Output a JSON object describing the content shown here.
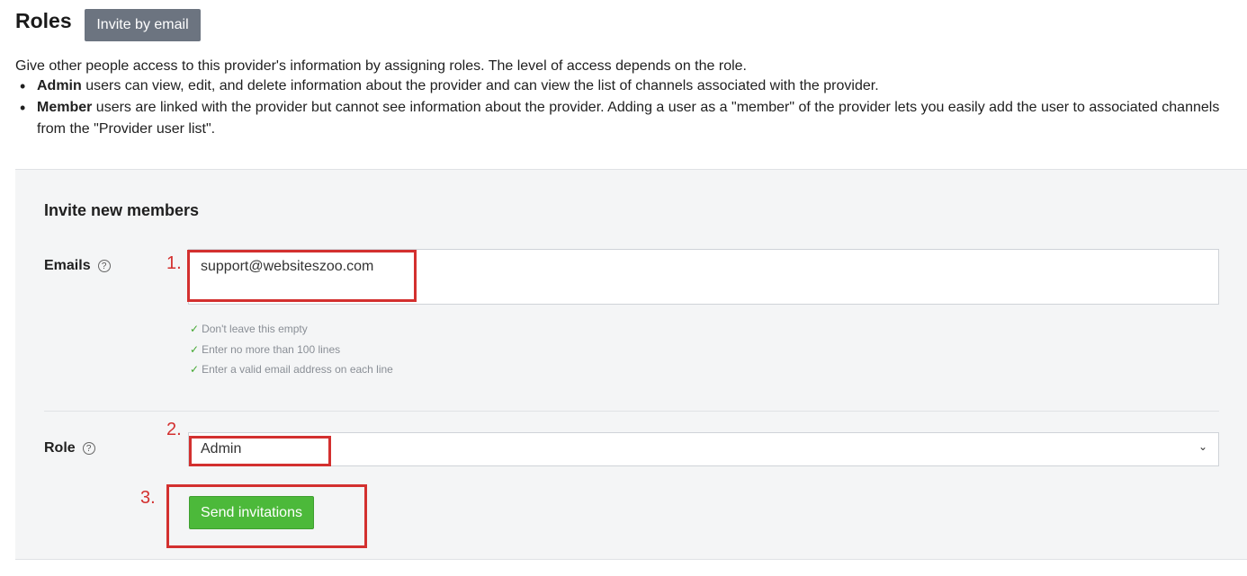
{
  "header": {
    "title": "Roles",
    "invite_button": "Invite by email"
  },
  "description": "Give other people access to this provider's information by assigning roles. The level of access depends on the role.",
  "bullets": [
    {
      "bold": "Admin",
      "text": " users can view, edit, and delete information about the provider and can view the list of channels associated with the provider."
    },
    {
      "bold": "Member",
      "text": " users are linked with the provider but cannot see information about the provider. Adding a user as a \"member\" of the provider lets you easily add the user to associated channels from the \"Provider user list\"."
    }
  ],
  "form": {
    "section_title": "Invite new members",
    "emails": {
      "label": "Emails",
      "help_icon": "question-circle-icon",
      "value": "support@websiteszoo.com",
      "rules": [
        "Don't leave this empty",
        "Enter no more than 100 lines",
        "Enter a valid email address on each line"
      ],
      "rule_icon": "check-icon"
    },
    "role": {
      "label": "Role",
      "help_icon": "question-circle-icon",
      "selected": "Admin",
      "chevron_icon": "chevron-down-icon"
    },
    "send_button": "Send invitations"
  },
  "annotations": {
    "step1": "1.",
    "step2": "2.",
    "step3": "3."
  },
  "colors": {
    "invite_button_bg": "#6c7480",
    "send_button_bg": "#4cb93a",
    "annotation_red": "#d3302f",
    "check_green": "#44a832"
  }
}
